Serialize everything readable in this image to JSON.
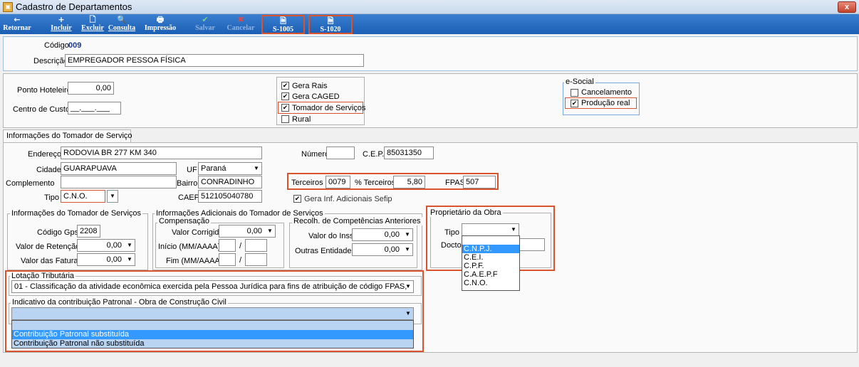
{
  "window": {
    "title": "Cadastro de Departamentos",
    "close_label": "x"
  },
  "toolbar": {
    "retornar": "Retornar",
    "incluir": "Incluir",
    "excluir": "Excluir",
    "consulta": "Consulta",
    "impressao": "Impressão",
    "salvar": "Salvar",
    "cancelar": "Cancelar",
    "s1005": "S-1005",
    "s1020": "S-1020"
  },
  "header": {
    "codigo_label": "Código",
    "codigo_value": "009",
    "descricao_label": "Descrição",
    "descricao_value": "EMPREGADOR PESSOA FÍSICA"
  },
  "top_panel": {
    "ponto_hoteleiro_label": "Ponto Hoteleiro",
    "ponto_hoteleiro_value": "0,00",
    "centro_custo_label": "Centro de Custo",
    "centro_custo_value": "__.___.___",
    "checks": [
      {
        "label": "Gera Rais",
        "checked": true
      },
      {
        "label": "Gera CAGED",
        "checked": true
      },
      {
        "label": "Tomador de Serviços",
        "checked": true
      },
      {
        "label": "Rural",
        "checked": false
      }
    ],
    "esocial_title": "e-Social",
    "esocial_checks": [
      {
        "label": "Cancelamento",
        "checked": false
      },
      {
        "label": "Produção real",
        "checked": true
      }
    ]
  },
  "tab": {
    "label": "Informações do Tomador de Serviço"
  },
  "tomador": {
    "endereco_label": "Endereço",
    "endereco_value": "RODOVIA BR 277 KM 340",
    "numero_label": "Número",
    "numero_value": "",
    "cep_label": "C.E.P.",
    "cep_value": "85031350",
    "cidade_label": "Cidade",
    "cidade_value": "GUARAPUAVA",
    "uf_label": "UF",
    "uf_value": "Paraná",
    "complemento_label": "Complemento",
    "complemento_value": "",
    "bairro_label": "Bairro",
    "bairro_value": "CONRADINHO",
    "terceiros_label": "Terceiros",
    "terceiros_value": "0079",
    "pct_terceiros_label": "% Terceiros",
    "pct_terceiros_value": "5,80",
    "fpas_label": "FPAS",
    "fpas_value": "507",
    "tipo_label": "Tipo",
    "tipo_value": "C.N.O.",
    "caepf_label": "CAEPF",
    "caepf_value": "512105040780",
    "gera_sefip_label": "Gera Inf. Adicionais Sefip"
  },
  "info_tomador_servicos": {
    "title": "Informações do Tomador de Serviços",
    "codigo_gps_label": "Código Gps",
    "codigo_gps_value": "2208",
    "valor_retencao_label": "Valor de Retenção",
    "valor_retencao_value": "0,00",
    "valor_faturas_label": "Valor das Faturas",
    "valor_faturas_value": "0,00"
  },
  "info_adicionais": {
    "title": "Informações Adicionais do Tomador de Serviços",
    "compensacao_title": "Compensação",
    "valor_corrigido_label": "Valor Corrigido",
    "valor_corrigido_value": "0,00",
    "inicio_label": "Início (MM/AAAA)",
    "fim_label": "Fim (MM/AAAA)",
    "slash": "/",
    "recolh_title": "Recolh. de Competências Anteriores",
    "valor_inss_label": "Valor do Inss",
    "valor_inss_value": "0,00",
    "outras_entidades_label": "Outras Entidades",
    "outras_entidades_value": "0,00"
  },
  "proprietario": {
    "title": "Proprietário da Obra",
    "tipo_label": "Tipo",
    "tipo_value": "",
    "docto_label": "Docto",
    "options": [
      "",
      "C.N.P.J.",
      "C.E.I.",
      "C.P.F.",
      "C.A.E.P.F",
      "C.N.O."
    ],
    "selected_index": 1
  },
  "lotacao": {
    "title": "Lotação Tributária",
    "value": "01 - Classificação da atividade econômica exercida pela Pessoa Jurídica para fins de atribuição de código FPAS,"
  },
  "indicativo": {
    "title": "Indicativo da contribuição Patronal - Obra de Construção Civil",
    "value": "",
    "options": [
      "",
      "Contribuição Patronal substituída",
      "Contribuição Patronal não substituída"
    ],
    "selected_index": 1
  },
  "icons": {
    "retornar": "←",
    "incluir": "+",
    "excluir": "🗋",
    "consulta": "🔍",
    "impressao": "🖶",
    "salvar": "✔",
    "cancelar": "✖",
    "doc": "🗎",
    "check": "✔",
    "dropdown": "▼"
  },
  "colors": {
    "toolbar": "#2a6fc4",
    "highlight": "#d9532c",
    "selection": "#3399ff"
  }
}
